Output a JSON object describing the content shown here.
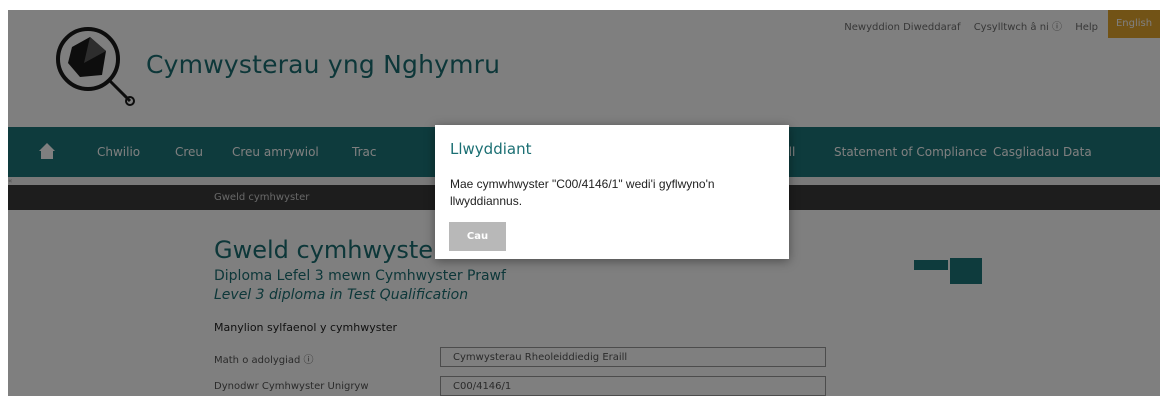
{
  "header": {
    "site_title": "Cymwysterau yng Nghymru",
    "util_links": [
      "Newyddion Diweddaraf",
      "Cysylltwch â ni ⓘ",
      "Help"
    ],
    "language_button": "English"
  },
  "nav": {
    "items": [
      "Chwilio",
      "Creu",
      "Creu amrywiol",
      "Trac",
      "aill",
      "Statement of Compliance",
      "Casgliadau Data"
    ]
  },
  "thin_strip": "«",
  "breadcrumb": "Gweld cymhwyster",
  "page": {
    "title": "Gweld cymhwyster",
    "subtitle_cy": "Diploma Lefel 3 mewn Cymhwyster Prawf",
    "subtitle_en": "Level 3 diploma in Test Qualification",
    "section_heading": "Manylion sylfaenol y cymhwyster"
  },
  "fields": [
    {
      "label": "Math o adolygiad ⓘ",
      "value": "Cymwysterau Rheoleiddiedig Eraill"
    },
    {
      "label": "Dynodwr Cymhwyster Unigryw",
      "value": "C00/4146/1"
    }
  ],
  "modal": {
    "title": "Llwyddiant",
    "message": "Mae cymwhwyster \"C00/4146/1\" wedi'i gyflwyno'n llwyddiannus.",
    "close_label": "Cau"
  },
  "colors": {
    "brand_teal": "#1c777a",
    "accent_orange": "#e4a62c",
    "dark_bar": "#3a3a3a"
  }
}
